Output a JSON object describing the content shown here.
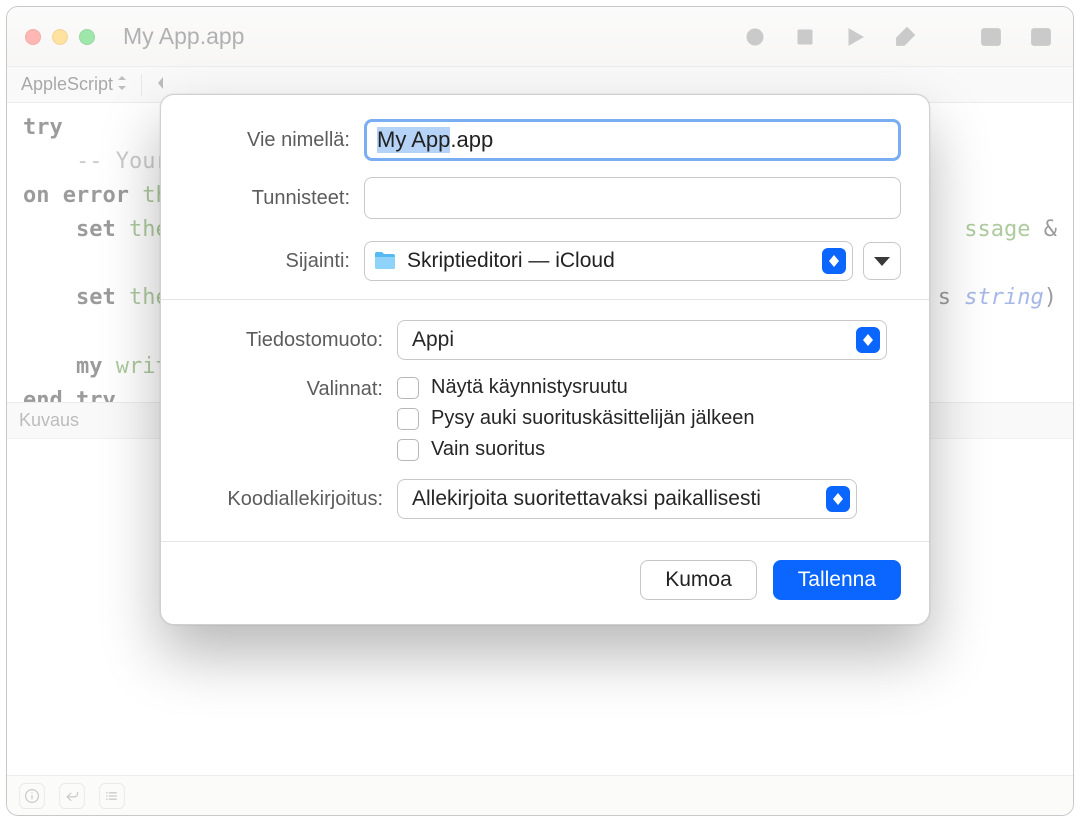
{
  "window": {
    "title": "My App.app"
  },
  "navbar": {
    "language": "AppleScript"
  },
  "editor": {
    "l1_try": "try",
    "l2_comment": "-- Your",
    "l3_on_error": "on error",
    "l3_the": " the",
    "l4_set": "set",
    "l4_the": " the",
    "l4_tail_ssage": "ssage",
    "l4_amp": " &",
    "l5_set": "set",
    "l5_the": " the",
    "l5_s": "s ",
    "l5_string": "string",
    "l5_paren": ")",
    "l6_my": "my",
    "l6_writ": " writ",
    "l7_end_try": "end try"
  },
  "desc": {
    "label": "Kuvaus"
  },
  "modal": {
    "save_as_label": "Vie nimellä:",
    "save_as_value_sel": "My App",
    "save_as_value_ext": ".app",
    "tags_label": "Tunnisteet:",
    "location_label": "Sijainti:",
    "location_value": "Skriptieditori — iCloud",
    "format_label": "Tiedostomuoto:",
    "format_value": "Appi",
    "options_label": "Valinnat:",
    "opt_startup": "Näytä käynnistysruutu",
    "opt_stayopen": "Pysy auki suorituskäsittelijän jälkeen",
    "opt_runonly": "Vain suoritus",
    "codesign_label": "Koodiallekirjoitus:",
    "codesign_value": "Allekirjoita suoritettavaksi paikallisesti",
    "cancel": "Kumoa",
    "save": "Tallenna"
  }
}
